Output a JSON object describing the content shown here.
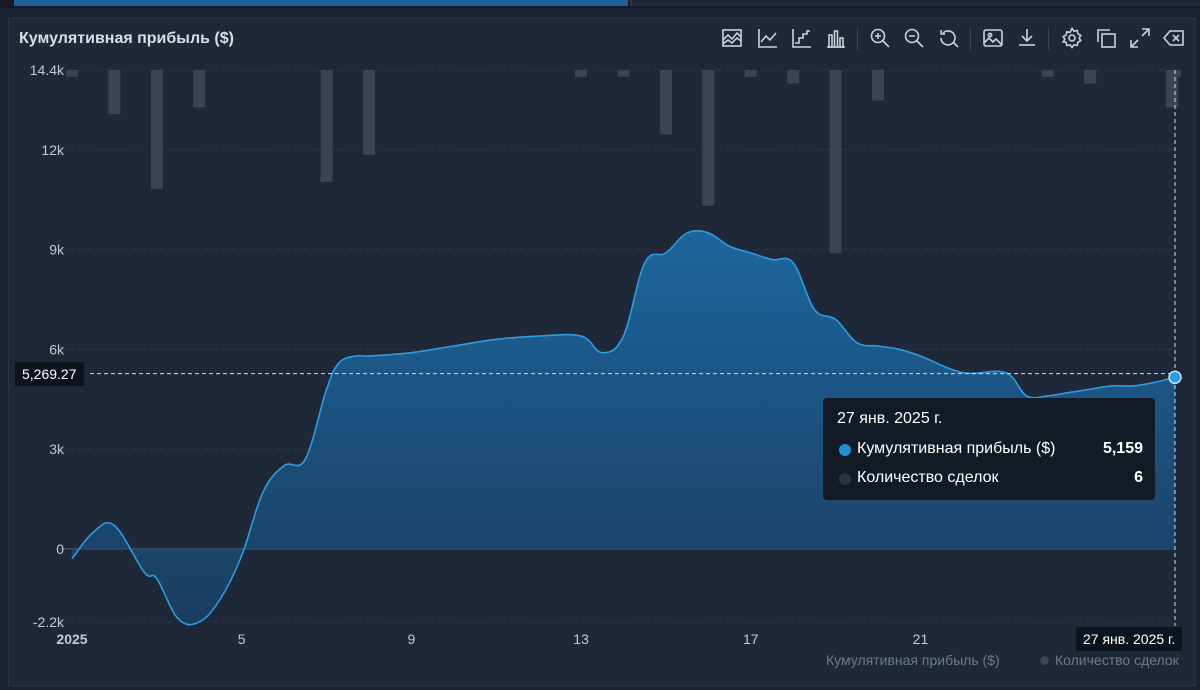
{
  "title": "Кумулятивная прибыль ($)",
  "toolbar": [
    {
      "name": "area-chart-icon"
    },
    {
      "name": "line-chart-icon"
    },
    {
      "name": "step-chart-icon"
    },
    {
      "name": "bar-chart-icon"
    },
    {
      "name": "zoom-in-icon"
    },
    {
      "name": "zoom-out-icon"
    },
    {
      "name": "reset-zoom-icon"
    },
    {
      "name": "save-image-icon"
    },
    {
      "name": "download-icon"
    },
    {
      "name": "settings-icon"
    },
    {
      "name": "copy-icon"
    },
    {
      "name": "fullscreen-icon"
    },
    {
      "name": "clear-icon"
    }
  ],
  "crosshair": {
    "y_label": "5,269.27",
    "x_label": "27 янв. 2025 г."
  },
  "tooltip": {
    "date": "27 янв. 2025 г.",
    "rows": [
      {
        "label": "Кумулятивная прибыль ($)",
        "value": "5,159",
        "color": "#1e8fd8"
      },
      {
        "label": "Количество сделок",
        "value": "6",
        "color": "#2a3344"
      }
    ]
  },
  "legend": [
    "Кумулятивная прибыль ($)",
    "Количество сделок"
  ],
  "colors": {
    "line": "#2e9be0",
    "area_top": "#1d6aa3",
    "area_bottom": "#1a3f63",
    "bars": "#3a4454",
    "grid": "#2c3649",
    "axis_text": "#c3cad4"
  },
  "chart_data": {
    "type": "area",
    "x_ticks": [
      "2025",
      "5",
      "9",
      "13",
      "17",
      "21"
    ],
    "y_ticks": [
      "14.4k",
      "12k",
      "9k",
      "6k",
      "3k",
      "0",
      "-2.2k"
    ],
    "ylim": [
      -2200,
      14400
    ],
    "series": [
      {
        "name": "Кумулятивная прибыль ($)",
        "type": "area",
        "x": [
          1.0,
          1.5,
          2.0,
          2.7,
          3.0,
          3.5,
          4.0,
          4.5,
          5.0,
          5.5,
          6.0,
          6.5,
          7.0,
          7.3,
          7.7,
          8.0,
          9.0,
          10.0,
          11.0,
          12.0,
          13.0,
          13.5,
          14.0,
          14.5,
          15.0,
          15.5,
          16.0,
          16.5,
          17.0,
          17.5,
          18.0,
          18.5,
          19.0,
          19.5,
          20.0,
          20.5,
          21.0,
          22.0,
          23.0,
          23.5,
          24.0,
          24.5,
          25.0,
          25.5,
          26.0,
          26.5,
          27.0
        ],
        "values": [
          -300,
          500,
          700,
          -700,
          -900,
          -2100,
          -2200,
          -1500,
          -200,
          1700,
          2500,
          2700,
          4800,
          5600,
          5800,
          5800,
          5900,
          6100,
          6300,
          6400,
          6400,
          5900,
          6400,
          8600,
          8900,
          9500,
          9500,
          9100,
          8900,
          8700,
          8600,
          7200,
          6900,
          6200,
          6100,
          6000,
          5800,
          5300,
          5300,
          4600,
          4600,
          4700,
          4800,
          4900,
          4900,
          5000,
          5159
        ]
      },
      {
        "name": "Количество сделок",
        "type": "bar",
        "x": [
          1,
          2,
          3,
          4,
          7,
          8,
          13,
          14,
          15,
          16,
          17,
          18,
          19,
          20,
          24,
          25,
          27,
          28
        ],
        "values": [
          0.2,
          1.3,
          3.5,
          1.1,
          3.3,
          2.5,
          0.2,
          0.2,
          1.9,
          4.0,
          0.2,
          0.4,
          5.4,
          0.9,
          0.2,
          0.4,
          0.2,
          1.1
        ]
      }
    ],
    "crosshair_value": 5269.27,
    "grid": true,
    "legend_position": "bottom-right"
  }
}
